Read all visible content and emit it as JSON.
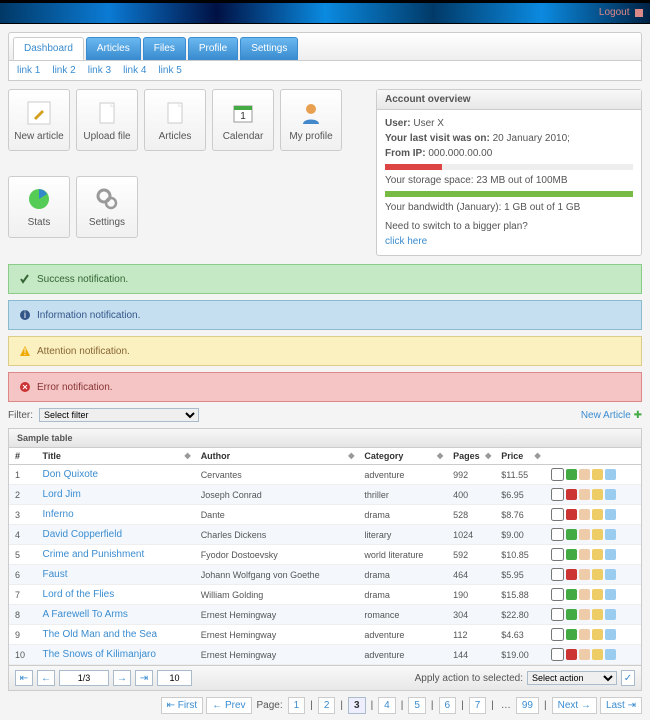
{
  "header": {
    "logout_label": "Logout"
  },
  "tabs": [
    "Dashboard",
    "Articles",
    "Files",
    "Profile",
    "Settings"
  ],
  "active_tab": 0,
  "links": [
    "link 1",
    "link 2",
    "link 3",
    "link 4",
    "link 5"
  ],
  "tiles": [
    {
      "label": "New article",
      "icon": "pencil",
      "color": "#d4a020"
    },
    {
      "label": "Upload file",
      "icon": "doc",
      "color": "#bbb"
    },
    {
      "label": "Articles",
      "icon": "doc",
      "color": "#bbb"
    },
    {
      "label": "Calendar",
      "icon": "calendar",
      "color": "#4a4"
    },
    {
      "label": "My profile",
      "icon": "person",
      "color": "#e8a050"
    },
    {
      "label": "Stats",
      "icon": "pie",
      "color": "#5c5"
    },
    {
      "label": "Settings",
      "icon": "gears",
      "color": "#999"
    }
  ],
  "overview": {
    "title": "Account overview",
    "user_label": "User:",
    "user_value": "User X",
    "visit_label": "Your last visit was on:",
    "visit_value": "20 January 2010;",
    "ip_label": "From IP:",
    "ip_value": "000.000.00.00",
    "storage_text": "Your storage space: 23 MB out of 100MB",
    "storage_pct": 23,
    "storage_color": "#d44",
    "bandwidth_text": "Your bandwidth (January): 1 GB out of 1 GB",
    "bandwidth_pct": 100,
    "bandwidth_color": "#7b4",
    "upgrade_text": "Need to switch to a bigger plan?",
    "upgrade_link": "click here"
  },
  "notifications": {
    "success": "Success notification.",
    "info": "Information notification.",
    "attention": "Attention notification.",
    "error": "Error notification."
  },
  "filter": {
    "label": "Filter:",
    "select": "Select filter",
    "new_article": "New Article"
  },
  "table": {
    "title": "Sample table",
    "columns": [
      "#",
      "Title",
      "Author",
      "Category",
      "Pages",
      "Price",
      ""
    ],
    "rows": [
      {
        "n": 1,
        "title": "Don Quixote",
        "author": "Cervantes",
        "cat": "adventure",
        "pages": 992,
        "price": "$11.55",
        "status": "ok"
      },
      {
        "n": 2,
        "title": "Lord Jim",
        "author": "Joseph Conrad",
        "cat": "thriller",
        "pages": 400,
        "price": "$6.95",
        "status": "no"
      },
      {
        "n": 3,
        "title": "Inferno",
        "author": "Dante",
        "cat": "drama",
        "pages": 528,
        "price": "$8.76",
        "status": "no"
      },
      {
        "n": 4,
        "title": "David Copperfield",
        "author": "Charles Dickens",
        "cat": "literary",
        "pages": 1024,
        "price": "$9.00",
        "status": "ok"
      },
      {
        "n": 5,
        "title": "Crime and Punishment",
        "author": "Fyodor Dostoevsky",
        "cat": "world literature",
        "pages": 592,
        "price": "$10.85",
        "status": "ok"
      },
      {
        "n": 6,
        "title": "Faust",
        "author": "Johann Wolfgang von Goethe",
        "cat": "drama",
        "pages": 464,
        "price": "$5.95",
        "status": "no"
      },
      {
        "n": 7,
        "title": "Lord of the Flies",
        "author": "William Golding",
        "cat": "drama",
        "pages": 190,
        "price": "$15.88",
        "status": "ok"
      },
      {
        "n": 8,
        "title": "A Farewell To Arms",
        "author": "Ernest Hemingway",
        "cat": "romance",
        "pages": 304,
        "price": "$22.80",
        "status": "ok"
      },
      {
        "n": 9,
        "title": "The Old Man and the Sea",
        "author": "Ernest Hemingway",
        "cat": "adventure",
        "pages": 112,
        "price": "$4.63",
        "status": "ok"
      },
      {
        "n": 10,
        "title": "The Snows of Kilimanjaro",
        "author": "Ernest Hemingway",
        "cat": "adventure",
        "pages": 144,
        "price": "$19.00",
        "status": "no"
      }
    ],
    "footer": {
      "page_of": "1/3",
      "per_page": "10",
      "apply_label": "Apply action to selected:",
      "apply_select": "Select action"
    }
  },
  "pager": {
    "label": "Page:",
    "pages": [
      "1",
      "2",
      "3",
      "4",
      "5",
      "6",
      "7",
      "…",
      "99"
    ],
    "active": 2,
    "first": "First",
    "prev": "Prev",
    "next": "Next",
    "last": "Last"
  }
}
